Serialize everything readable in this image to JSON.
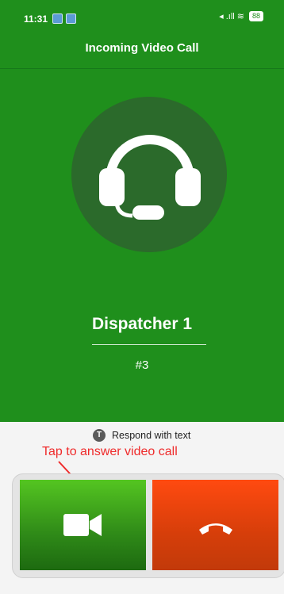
{
  "status_bar": {
    "time": "11:31",
    "signal": "◂ .ıll ≋",
    "battery": "88"
  },
  "header": {
    "title": "Incoming Video Call"
  },
  "caller": {
    "avatar_icon": "headset-icon",
    "name": "Dispatcher 1",
    "number": "#3"
  },
  "respond": {
    "icon_letter": "T",
    "label": "Respond with text"
  },
  "annotation": {
    "hint": "Tap to answer video call"
  },
  "actions": {
    "accept_icon": "video-camera-icon",
    "decline_icon": "hang-up-icon"
  },
  "colors": {
    "header_green": "#1f8f1c",
    "accept_green": "#3fa31c",
    "decline_red": "#e8420e",
    "hint_red": "#ef2b2b"
  }
}
